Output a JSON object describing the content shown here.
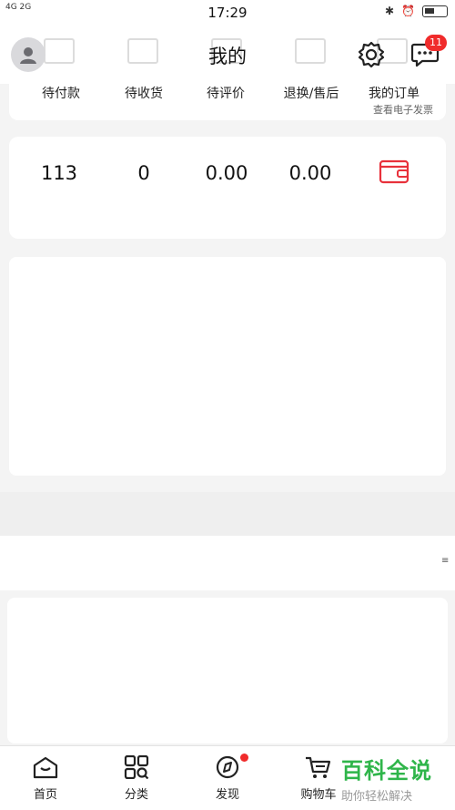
{
  "status_bar": {
    "signal_left": "4G 2G",
    "time": "17:29",
    "icons": [
      "bluetooth-icon",
      "alarm-icon",
      "battery-icon"
    ]
  },
  "header": {
    "title": "我的",
    "message_badge": "11"
  },
  "orders": {
    "items": [
      "待付款",
      "待收货",
      "待评价",
      "退换/售后",
      "我的订单"
    ],
    "invoice_link": "查看电子发票"
  },
  "assets": {
    "values": [
      "113",
      "0",
      "0.00",
      "0.00"
    ]
  },
  "tabbar": {
    "items": [
      "首页",
      "分类",
      "发现",
      "购物车"
    ]
  },
  "watermark": {
    "title": "百科全说",
    "subtitle": "助你轻松解决"
  },
  "colors": {
    "accent_red": "#f02b2b",
    "watermark_green": "#2fb54a"
  }
}
